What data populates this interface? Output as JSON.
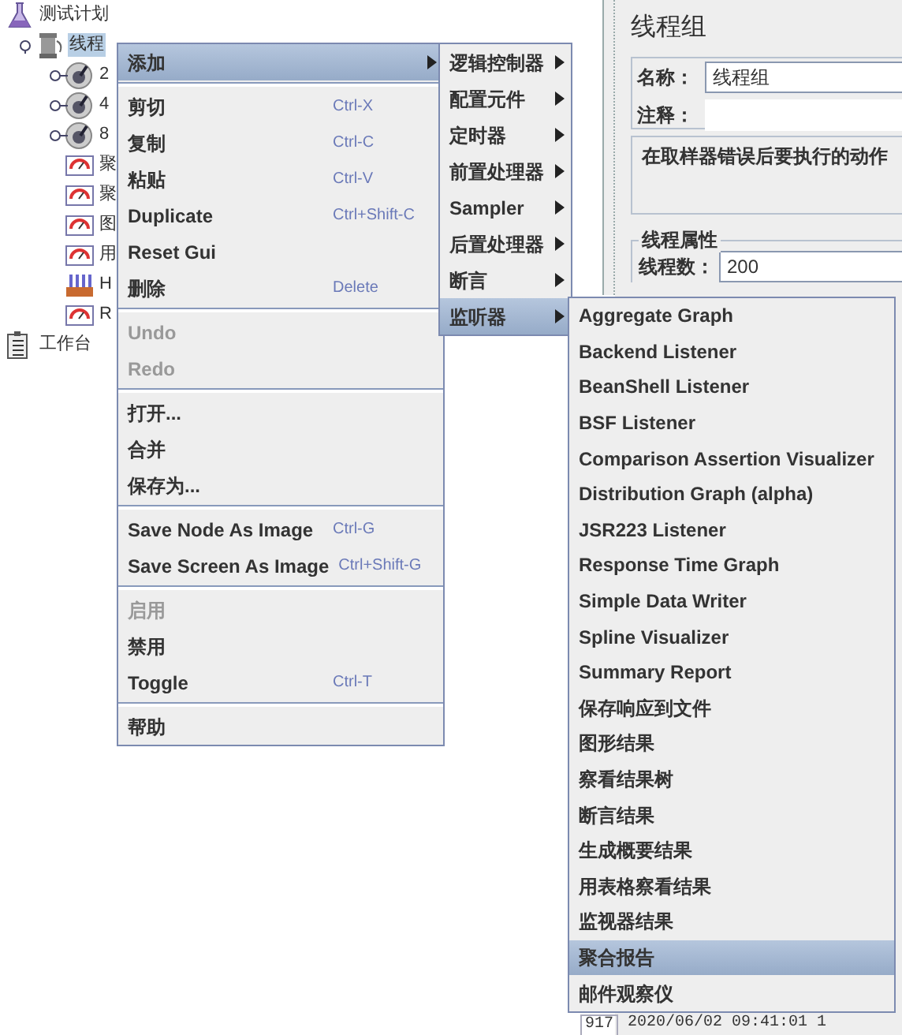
{
  "tree": [
    {
      "label": "测试计划",
      "kind": "plan",
      "selected": false,
      "children": [
        {
          "label": "线程",
          "kind": "threadgroup",
          "selected": true,
          "expanded": true,
          "children": [
            {
              "label": "2",
              "kind": "controller",
              "selected": false,
              "expanded": false
            },
            {
              "label": "4",
              "kind": "controller",
              "selected": false,
              "expanded": false
            },
            {
              "label": "8",
              "kind": "controller",
              "selected": false,
              "expanded": false
            },
            {
              "label": "聚",
              "kind": "listener",
              "selected": false
            },
            {
              "label": "聚",
              "kind": "listener",
              "selected": false
            },
            {
              "label": "图",
              "kind": "listener",
              "selected": false
            },
            {
              "label": "用",
              "kind": "listener",
              "selected": false
            },
            {
              "label": "H",
              "kind": "http",
              "selected": false
            },
            {
              "label": "R",
              "kind": "listener",
              "selected": false
            }
          ]
        }
      ]
    },
    {
      "label": "工作台",
      "kind": "workbench",
      "selected": false
    }
  ],
  "panel": {
    "title": "线程组",
    "name_label": "名称：",
    "name_value": "线程组",
    "comment_label": "注释：",
    "error_group": "在取样器错误后要执行的动作",
    "thread_group": "线程属性",
    "threads_label": "线程数：",
    "threads_value": "200"
  },
  "log_row": {
    "number": "917",
    "text": "2020/06/02 09:41:01 1"
  },
  "context_menu": [
    {
      "kind": "item",
      "label": "添加",
      "selected": true,
      "submenu": true,
      "disabled": false
    },
    {
      "kind": "separator"
    },
    {
      "kind": "item",
      "label": "剪切",
      "shortcut": "Ctrl-X",
      "selected": false,
      "disabled": false
    },
    {
      "kind": "item",
      "label": "复制",
      "shortcut": "Ctrl-C",
      "selected": false,
      "disabled": false
    },
    {
      "kind": "item",
      "label": "粘贴",
      "shortcut": "Ctrl-V",
      "selected": false,
      "disabled": false
    },
    {
      "kind": "item",
      "label": "Duplicate",
      "shortcut": "Ctrl+Shift-C",
      "selected": false,
      "disabled": false
    },
    {
      "kind": "item",
      "label": "Reset Gui",
      "selected": false,
      "disabled": false
    },
    {
      "kind": "item",
      "label": "删除",
      "shortcut": "Delete",
      "selected": false,
      "disabled": false
    },
    {
      "kind": "separator"
    },
    {
      "kind": "item",
      "label": "Undo",
      "selected": false,
      "disabled": true
    },
    {
      "kind": "item",
      "label": "Redo",
      "selected": false,
      "disabled": true
    },
    {
      "kind": "separator"
    },
    {
      "kind": "item",
      "label": "打开...",
      "selected": false,
      "disabled": false
    },
    {
      "kind": "item",
      "label": "合并",
      "selected": false,
      "disabled": false
    },
    {
      "kind": "item",
      "label": "保存为...",
      "selected": false,
      "disabled": false
    },
    {
      "kind": "separator"
    },
    {
      "kind": "item",
      "label": "Save Node As Image",
      "shortcut": "Ctrl-G",
      "selected": false,
      "disabled": false
    },
    {
      "kind": "item",
      "label": "Save Screen As Image",
      "shortcut": "Ctrl+Shift-G",
      "selected": false,
      "disabled": false
    },
    {
      "kind": "separator"
    },
    {
      "kind": "item",
      "label": "启用",
      "selected": false,
      "disabled": true
    },
    {
      "kind": "item",
      "label": "禁用",
      "selected": false,
      "disabled": false
    },
    {
      "kind": "item",
      "label": "Toggle",
      "shortcut": "Ctrl-T",
      "selected": false,
      "disabled": false
    },
    {
      "kind": "separator"
    },
    {
      "kind": "item",
      "label": "帮助",
      "selected": false,
      "disabled": false
    }
  ],
  "add_submenu": [
    {
      "label": "逻辑控制器",
      "submenu": true,
      "selected": false
    },
    {
      "label": "配置元件",
      "submenu": true,
      "selected": false
    },
    {
      "label": "定时器",
      "submenu": true,
      "selected": false
    },
    {
      "label": "前置处理器",
      "submenu": true,
      "selected": false
    },
    {
      "label": "Sampler",
      "submenu": true,
      "selected": false
    },
    {
      "label": "后置处理器",
      "submenu": true,
      "selected": false
    },
    {
      "label": "断言",
      "submenu": true,
      "selected": false
    },
    {
      "label": "监听器",
      "submenu": true,
      "selected": true
    }
  ],
  "listener_submenu": [
    {
      "label": "Aggregate Graph",
      "selected": false
    },
    {
      "label": "Backend Listener",
      "selected": false
    },
    {
      "label": "BeanShell Listener",
      "selected": false
    },
    {
      "label": "BSF Listener",
      "selected": false
    },
    {
      "label": "Comparison Assertion Visualizer",
      "selected": false
    },
    {
      "label": "Distribution Graph (alpha)",
      "selected": false
    },
    {
      "label": "JSR223 Listener",
      "selected": false
    },
    {
      "label": "Response Time Graph",
      "selected": false
    },
    {
      "label": "Simple Data Writer",
      "selected": false
    },
    {
      "label": "Spline Visualizer",
      "selected": false
    },
    {
      "label": "Summary Report",
      "selected": false
    },
    {
      "label": "保存响应到文件",
      "selected": false
    },
    {
      "label": "图形结果",
      "selected": false
    },
    {
      "label": "察看结果树",
      "selected": false
    },
    {
      "label": "断言结果",
      "selected": false
    },
    {
      "label": "生成概要结果",
      "selected": false
    },
    {
      "label": "用表格察看结果",
      "selected": false
    },
    {
      "label": "监视器结果",
      "selected": false
    },
    {
      "label": "聚合报告",
      "selected": true
    },
    {
      "label": "邮件观察仪",
      "selected": false
    }
  ]
}
